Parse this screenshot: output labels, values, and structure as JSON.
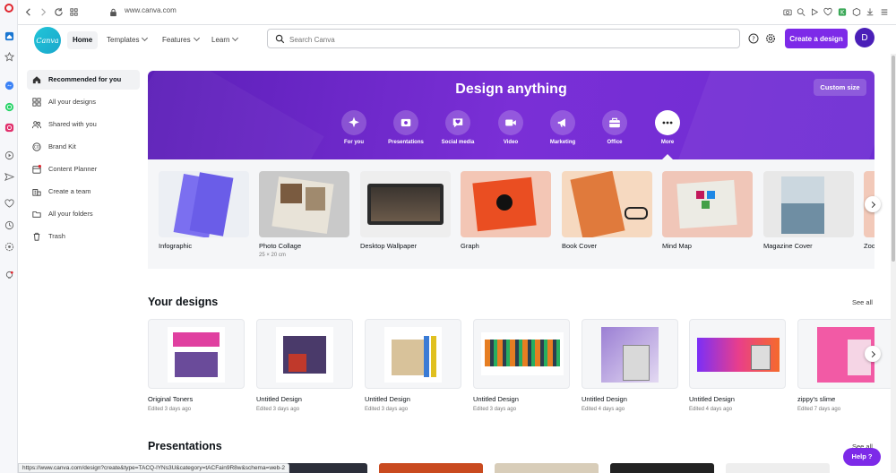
{
  "browser": {
    "url": "www.canva.com",
    "status_url": "https://www.canva.com/design?create&type=TACQ-lYNs3U&category=tACFain9R8w&schema=web-2"
  },
  "header": {
    "logo_text": "Canva",
    "nav": [
      {
        "label": "Home"
      },
      {
        "label": "Templates"
      },
      {
        "label": "Features"
      },
      {
        "label": "Learn"
      }
    ],
    "search_placeholder": "Search Canva",
    "create_label": "Create a design",
    "avatar_initial": "D"
  },
  "sidebar": {
    "items": [
      {
        "label": "Recommended for you",
        "icon": "home-icon"
      },
      {
        "label": "All your designs",
        "icon": "grid-icon"
      },
      {
        "label": "Shared with you",
        "icon": "users-icon"
      },
      {
        "label": "Brand Kit",
        "icon": "brand-icon"
      },
      {
        "label": "Content Planner",
        "icon": "calendar-icon"
      },
      {
        "label": "Create a team",
        "icon": "team-icon"
      },
      {
        "label": "All your folders",
        "icon": "folder-icon"
      },
      {
        "label": "Trash",
        "icon": "trash-icon"
      }
    ]
  },
  "hero": {
    "title": "Design anything",
    "custom_size": "Custom size",
    "categories": [
      {
        "label": "For you",
        "icon": "sparkle-icon"
      },
      {
        "label": "Presentations",
        "icon": "presentation-icon"
      },
      {
        "label": "Social media",
        "icon": "heart-chat-icon"
      },
      {
        "label": "Video",
        "icon": "video-icon"
      },
      {
        "label": "Marketing",
        "icon": "megaphone-icon"
      },
      {
        "label": "Office",
        "icon": "briefcase-icon"
      },
      {
        "label": "More",
        "icon": "more-icon"
      }
    ]
  },
  "templates": [
    {
      "title": "Infographic",
      "sub": ""
    },
    {
      "title": "Photo Collage",
      "sub": "25 × 20 cm"
    },
    {
      "title": "Desktop Wallpaper",
      "sub": ""
    },
    {
      "title": "Graph",
      "sub": ""
    },
    {
      "title": "Book Cover",
      "sub": ""
    },
    {
      "title": "Mind Map",
      "sub": ""
    },
    {
      "title": "Magazine Cover",
      "sub": ""
    },
    {
      "title": "Zoo",
      "sub": ""
    }
  ],
  "your_designs": {
    "title": "Your designs",
    "see_all": "See all",
    "items": [
      {
        "title": "Original Toners",
        "edited": "Edited 3 days ago"
      },
      {
        "title": "Untitled Design",
        "edited": "Edited 3 days ago"
      },
      {
        "title": "Untitled Design",
        "edited": "Edited 3 days ago"
      },
      {
        "title": "Untitled Design",
        "edited": "Edited 3 days ago"
      },
      {
        "title": "Untitled Design",
        "edited": "Edited 4 days ago"
      },
      {
        "title": "Untitled Design",
        "edited": "Edited 4 days ago"
      },
      {
        "title": "zippy's slime",
        "edited": "Edited 7 days ago"
      }
    ]
  },
  "presentations": {
    "title": "Presentations",
    "see_all": "See all"
  },
  "help_label": "Help ?"
}
